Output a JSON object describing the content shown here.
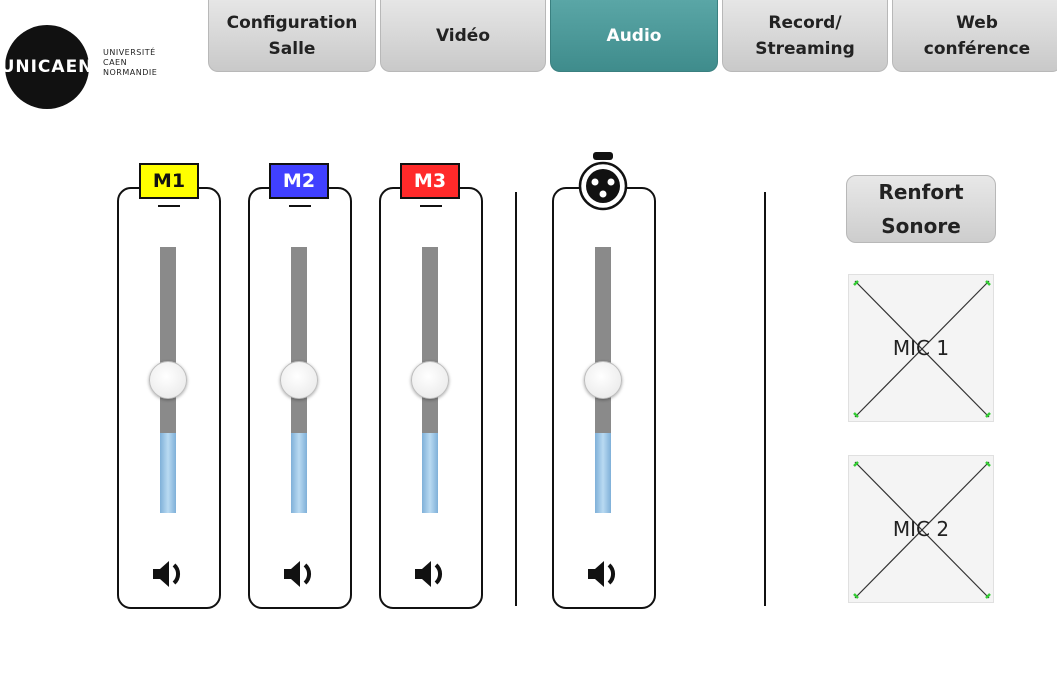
{
  "logo": {
    "mark": "UNICAEN",
    "lines": [
      "UNIVERSITÉ",
      "CAEN",
      "NORMANDIE"
    ]
  },
  "tabs": [
    {
      "label": "Configuration\nSalle",
      "active": false
    },
    {
      "label": "Vidéo",
      "active": false
    },
    {
      "label": "Audio",
      "active": true
    },
    {
      "label": "Record/\nStreaming",
      "active": false
    },
    {
      "label": "Web\nconférence",
      "active": false
    }
  ],
  "channels": [
    {
      "label": "M1",
      "badge_color": "#ffff00",
      "text_color": "#111111",
      "level": 0.3,
      "fader": 0.5,
      "icon": "speaker-icon"
    },
    {
      "label": "M2",
      "badge_color": "#4040ff",
      "text_color": "#ffffff",
      "level": 0.3,
      "fader": 0.5,
      "icon": "speaker-icon"
    },
    {
      "label": "M3",
      "badge_color": "#ff2a2a",
      "text_color": "#ffffff",
      "level": 0.3,
      "fader": 0.5,
      "icon": "speaker-icon"
    },
    {
      "label": "",
      "icon_top": "xlr-connector-icon",
      "level": 0.3,
      "fader": 0.5,
      "icon": "speaker-icon"
    }
  ],
  "renfort": {
    "label": "Renfort\nSonore"
  },
  "mics": [
    {
      "label": "MIC 1"
    },
    {
      "label": "MIC 2"
    }
  ],
  "colors": {
    "active_tab": "#4a9999",
    "led": "#33cc33"
  }
}
